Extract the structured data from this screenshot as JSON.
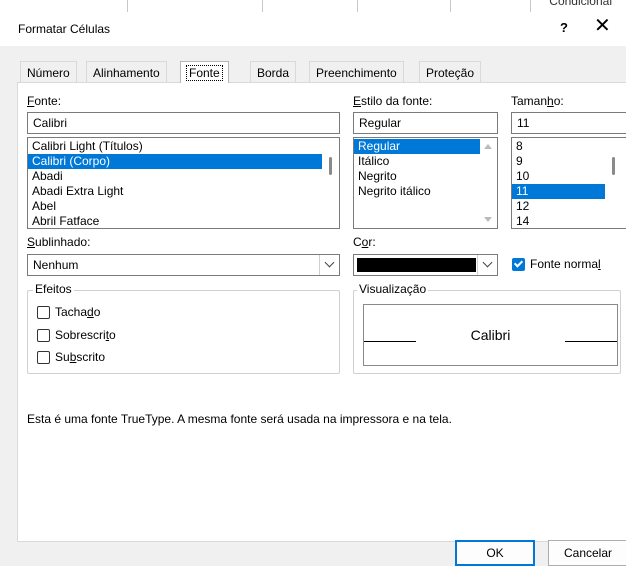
{
  "window": {
    "title": "Formatar Células",
    "help_label": "?",
    "close_label": "✕",
    "behind_text": "Condicional"
  },
  "tabs": [
    {
      "label": "Número"
    },
    {
      "label": "Alinhamento"
    },
    {
      "label": "Fonte",
      "active": true
    },
    {
      "label": "Borda"
    },
    {
      "label": "Preenchimento"
    },
    {
      "label": "Proteção"
    }
  ],
  "font": {
    "label_before": "",
    "label_mnemonic": "F",
    "label_after": "onte:",
    "value": "Calibri",
    "list": [
      "Calibri Light (Títulos)",
      "Calibri (Corpo)",
      "Abadi",
      "Abadi Extra Light",
      "Abel",
      "Abril Fatface"
    ],
    "selected_index": 1
  },
  "style": {
    "label_before": "",
    "label_mnemonic": "E",
    "label_after": "stilo da fonte:",
    "value": "Regular",
    "list": [
      "Regular",
      "Itálico",
      "Negrito",
      "Negrito itálico"
    ],
    "selected_index": 0
  },
  "size": {
    "label_before": "Taman",
    "label_mnemonic": "h",
    "label_after": "o:",
    "value": "11",
    "list": [
      "8",
      "9",
      "10",
      "11",
      "12",
      "14"
    ],
    "selected_index": 3
  },
  "underline": {
    "label_before": "",
    "label_mnemonic": "S",
    "label_after": "ublinhado:",
    "value": "Nenhum"
  },
  "color": {
    "label_before": "C",
    "label_mnemonic": "o",
    "label_after": "r:",
    "swatch": "#000000"
  },
  "normal_font": {
    "label_before": "Fonte norma",
    "label_mnemonic": "l",
    "label_after": "",
    "checked": true
  },
  "effects": {
    "legend": "Efeitos",
    "items": [
      {
        "before": "Tacha",
        "mn": "d",
        "after": "o",
        "checked": false
      },
      {
        "before": "Sobrescri",
        "mn": "t",
        "after": "o",
        "checked": false
      },
      {
        "before": "Su",
        "mn": "b",
        "after": "scrito",
        "checked": false
      }
    ]
  },
  "preview": {
    "legend": "Visualização",
    "text": "Calibri"
  },
  "info_text": "Esta é uma fonte TrueType. A mesma fonte será usada na impressora e na tela.",
  "buttons": {
    "ok": "OK",
    "cancel": "Cancelar"
  },
  "colors": {
    "accent": "#0078d7",
    "selection": "#0078d7"
  }
}
